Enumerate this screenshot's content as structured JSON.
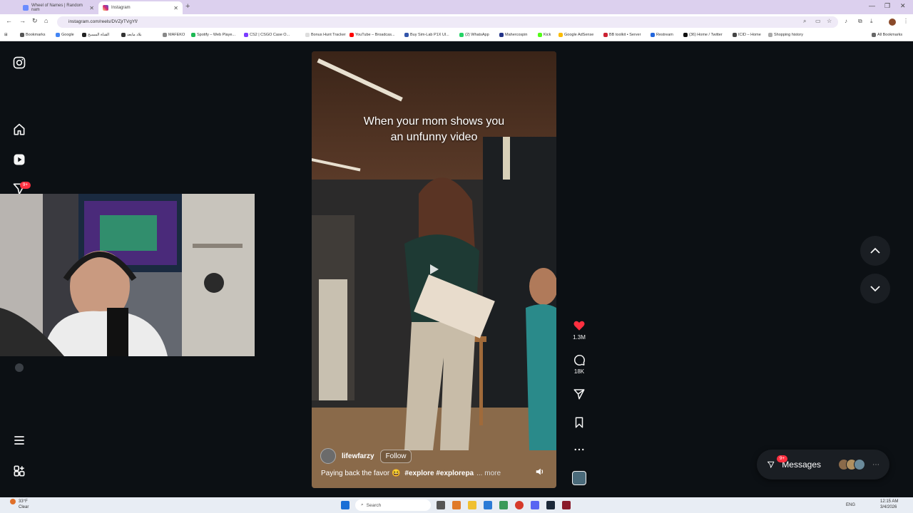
{
  "browser": {
    "tabs": [
      {
        "title": "Wheel of Names | Random nam",
        "active": false,
        "favicon_color": "#6b8cff"
      },
      {
        "title": "Instagram",
        "active": true,
        "favicon_color": "#d6249f"
      }
    ],
    "url": "instagram.com/reels/DVZjrTVgYf/",
    "bookmarks": [
      {
        "label": "Bookmarks",
        "color": "#555555"
      },
      {
        "label": "Google",
        "color": "#4285f4"
      },
      {
        "label": "القناة المسبح",
        "color": "#222222"
      },
      {
        "label": "بلاد مابعد",
        "color": "#333333"
      },
      {
        "label": "MAFEKO",
        "color": "#888888"
      },
      {
        "label": "Spotify – Web Playe...",
        "color": "#1db954"
      },
      {
        "label": "CS2 | CSGO Case O...",
        "color": "#7a3cff"
      },
      {
        "label": "Bonus Hunt Tracker",
        "color": "#dddddd"
      },
      {
        "label": "YouTube – Broadcas...",
        "color": "#ff0000"
      },
      {
        "label": "Buy Sim-Lab P1X Ul...",
        "color": "#3355aa"
      },
      {
        "label": "(2) WhatsApp",
        "color": "#25d366"
      },
      {
        "label": "Mahercospin",
        "color": "#223388"
      },
      {
        "label": "Kick",
        "color": "#53fc18"
      },
      {
        "label": "Google AdSense",
        "color": "#fbbc05"
      },
      {
        "label": "BB toolkit • Server",
        "color": "#cc2233"
      },
      {
        "label": "Restream",
        "color": "#2266dd"
      },
      {
        "label": "(36) Home / Twitter",
        "color": "#111111"
      },
      {
        "label": "ICID – Home",
        "color": "#444444"
      },
      {
        "label": "Shopping history",
        "color": "#aaaaaa"
      },
      {
        "label": "All Bookmarks",
        "color": "#666666"
      }
    ]
  },
  "rail": {
    "notifications_badge": "9+"
  },
  "reel": {
    "overlay_text_line1": "When your mom shows you",
    "overlay_text_line2": "an unfunny video",
    "author": "lifewfarzy",
    "follow_label": "Follow",
    "description": "Paying back the favor 😆",
    "hashtags": "#explore #explorepa",
    "more_label": "... more"
  },
  "actions": {
    "likes": "1.3M",
    "comments": "18K",
    "like_color": "#ff3040"
  },
  "messages": {
    "label": "Messages",
    "badge": "9+"
  },
  "taskbar": {
    "search_placeholder": "Search",
    "weather_temp": "33°F",
    "weather_desc": "Clear",
    "lang": "ENG",
    "time": "12:15 AM",
    "date": "3/4/2026"
  }
}
